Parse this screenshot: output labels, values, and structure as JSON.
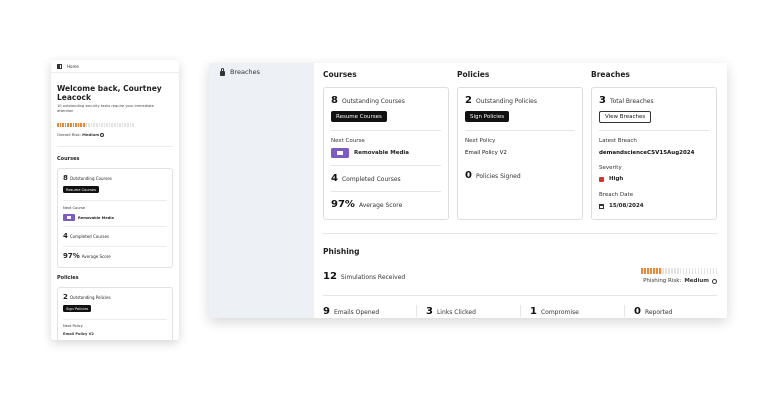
{
  "mobile": {
    "topbar": {
      "home_label": "Home"
    },
    "welcome": "Welcome back, Courtney Leacock",
    "subtitle": "10 outstanding security tasks require your immediate attention",
    "risk": {
      "label": "Overall Risk:",
      "value": "Medium",
      "level_fraction": 0.37
    },
    "courses": {
      "title": "Courses",
      "outstanding_count": "8",
      "outstanding_label": "Outstanding Courses",
      "resume_button": "Resume Courses",
      "next_label": "Next Course",
      "next_course": "Removable Media",
      "completed_count": "4",
      "completed_label": "Completed Courses",
      "average_value": "97%",
      "average_label": "Average Score"
    },
    "policies": {
      "title": "Policies",
      "outstanding_count": "2",
      "outstanding_label": "Outstanding Policies",
      "sign_button": "Sign Policies",
      "next_label": "Next Policy",
      "next_policy": "Email Policy V2"
    }
  },
  "desktop": {
    "sidebar": {
      "items": [
        {
          "label": "Breaches",
          "icon": "lock-icon"
        }
      ]
    },
    "courses": {
      "title": "Courses",
      "outstanding_count": "8",
      "outstanding_label": "Outstanding Courses",
      "resume_button": "Resume Courses",
      "next_label": "Next Course",
      "next_course": "Removable Media",
      "completed_count": "4",
      "completed_label": "Completed Courses",
      "average_value": "97%",
      "average_label": "Average Score"
    },
    "policies": {
      "title": "Policies",
      "outstanding_count": "2",
      "outstanding_label": "Outstanding Policies",
      "sign_button": "Sign Policies",
      "next_label": "Next Policy",
      "next_policy": "Email Policy V2",
      "signed_count": "0",
      "signed_label": "Policies Signed"
    },
    "breaches": {
      "title": "Breaches",
      "total_count": "3",
      "total_label": "Total Breaches",
      "view_button": "View Breaches",
      "latest_label": "Latest Breach",
      "latest_value": "demandscienceCSV15Aug2024",
      "severity_label": "Severity",
      "severity_value": "High",
      "date_label": "Breach Date",
      "date_value": "15/08/2024"
    },
    "phishing": {
      "title": "Phishing",
      "simulations_count": "12",
      "simulations_label": "Simulations Received",
      "risk_label": "Phishing Risk:",
      "risk_value": "Medium",
      "risk_level_fraction": 0.27,
      "stats": [
        {
          "count": "9",
          "label": "Emails Opened"
        },
        {
          "count": "3",
          "label": "Links Clicked"
        },
        {
          "count": "1",
          "label": "Compromise"
        },
        {
          "count": "0",
          "label": "Reported"
        }
      ]
    }
  },
  "colors": {
    "accent_purple": "#7c5cc4",
    "risk_orange": "#e8893a",
    "risk_empty": "#e3e3e3",
    "severity_red": "#d9342b"
  }
}
